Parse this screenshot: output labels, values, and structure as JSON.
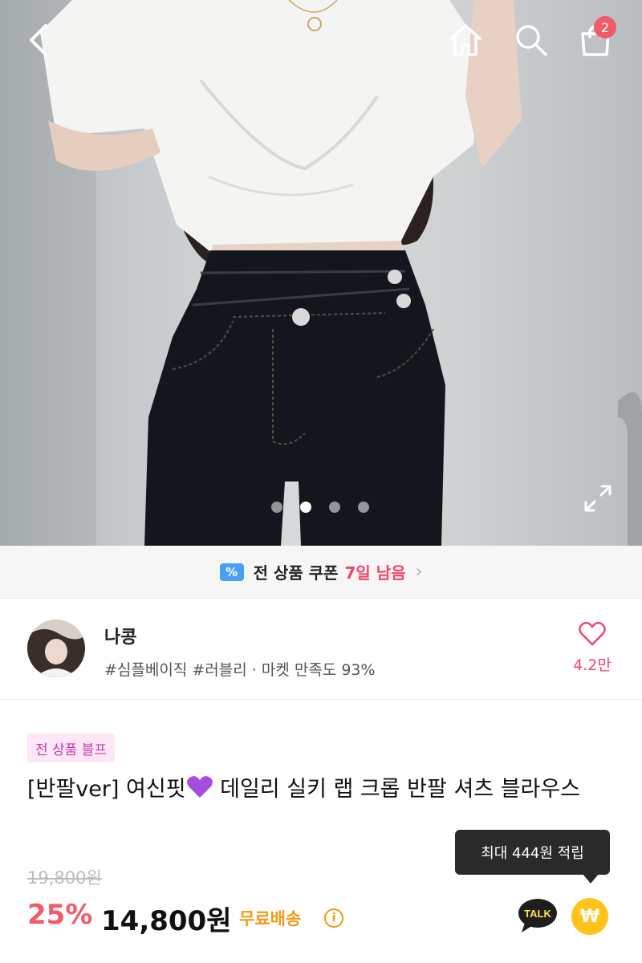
{
  "topbar": {
    "cart_count": "2",
    "icons": [
      "back-arrow-icon",
      "home-icon",
      "search-icon",
      "shopping-bag-icon"
    ]
  },
  "gallery": {
    "total_images": 4,
    "current_index": 2
  },
  "coupon_strip": {
    "icon_label": "%",
    "label": "전 상품 쿠폰",
    "remaining": "7일 남음"
  },
  "store": {
    "name": "나콩",
    "tags": "#심플베이직 #러블리 · 마켓 만족도 93%",
    "like_count": "4.2만"
  },
  "product": {
    "promo_badge": "전 상품 블프",
    "title_prefix": "[반팔ver] 여신핏",
    "title_suffix": " 데일리 실키 랩 크롭 반팔 셔츠 블라우스",
    "original_price": "19,800원",
    "discount_rate": "25%",
    "sale_price": "14,800원",
    "shipping": "무료배송",
    "info_icon": "i"
  },
  "actions": {
    "points_tooltip": "최대 444원 적립",
    "talk_label": "TALK",
    "points_symbol": "₩"
  },
  "colors": {
    "accent_pink": "#f25c6a",
    "coupon_red": "#f0456a",
    "shipping_orange": "#f19a12",
    "badge_bg": "#fde7f6",
    "badge_text": "#c23aa8",
    "points_yellow": "#ffc31a"
  }
}
